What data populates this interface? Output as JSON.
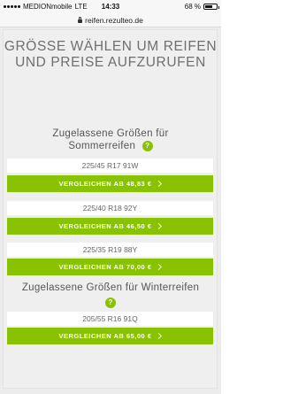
{
  "status_bar": {
    "carrier": "MEDIONmobile",
    "network": "LTE",
    "time": "14:33",
    "battery_text": "68 %",
    "battery_level": 0.68
  },
  "browser": {
    "url": "reifen.rezulteo.de"
  },
  "main": {
    "title": "GRÖSSE WÄHLEN UM REIFEN UND PREISE AUFZURUFEN",
    "summer": {
      "title_line1": "Zugelassene Größen für",
      "title_line2": "Sommerreifen",
      "help": "?",
      "items": [
        {
          "size": "225/45 R17 91W",
          "button": "VERGLEICHEN AB 48,83 €"
        },
        {
          "size": "225/40 R18 92Y",
          "button": "VERGLEICHEN AB 46,50 €"
        },
        {
          "size": "225/35 R19 88Y",
          "button": "VERGLEICHEN AB 70,00 €"
        }
      ]
    },
    "winter": {
      "title": "Zugelassene Größen für Winterreifen",
      "help": "?",
      "items": [
        {
          "size": "205/55 R16 91Q",
          "button": "VERGLEICHEN AB 65,00 €"
        }
      ]
    }
  },
  "colors": {
    "accent_green": "#88c200",
    "background": "#efefef"
  },
  "icons": [
    "signal-icon",
    "lock-icon",
    "battery-icon",
    "help-icon",
    "chevron-right-icon"
  ]
}
